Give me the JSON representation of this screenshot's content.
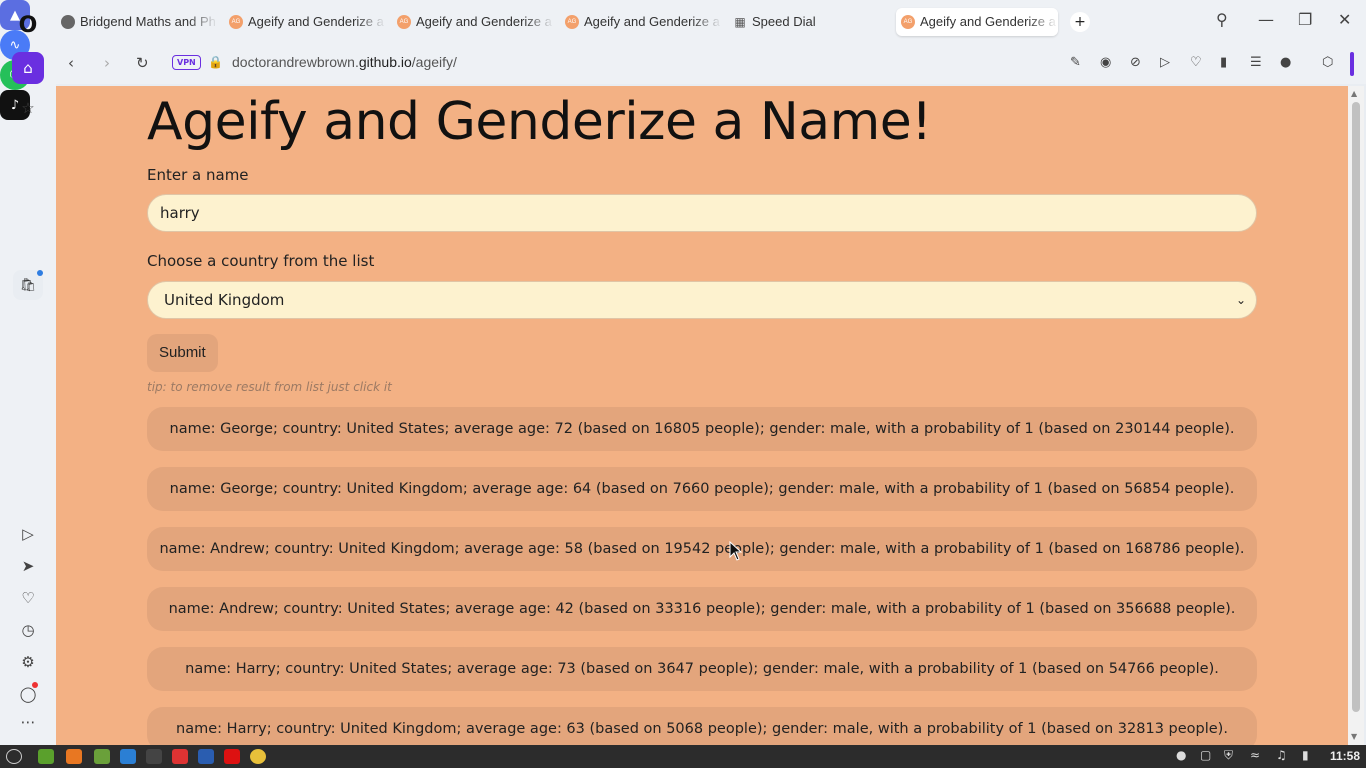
{
  "browser": {
    "tabs": [
      {
        "title": "Bridgend Maths and Ph"
      },
      {
        "title": "Ageify and Genderize a"
      },
      {
        "title": "Ageify and Genderize a"
      },
      {
        "title": "Ageify and Genderize a"
      },
      {
        "title": "Speed Dial"
      },
      {
        "title": "Ageify and Genderize a",
        "active": true
      }
    ],
    "favicon_text": "AG",
    "vpn_label": "VPN",
    "url_domain": "doctorandrewbrown.",
    "url_host": "github.io",
    "url_path": "/ageify/"
  },
  "page": {
    "title": "Ageify and Genderize a Name!",
    "name_label": "Enter a name",
    "name_value": "harry",
    "country_label": "Choose a country from the list",
    "country_selected": "United Kingdom",
    "submit_label": "Submit",
    "tip": "tip: to remove result from list just click it",
    "results": [
      "name: George; country: United States; average age: 72 (based on 16805 people); gender: male, with a probability of 1 (based on 230144 people).",
      "name: George; country: United Kingdom; average age: 64 (based on 7660 people); gender: male, with a probability of 1 (based on 56854 people).",
      "name: Andrew; country: United Kingdom; average age: 58 (based on 19542 people); gender: male, with a probability of 1 (based on 168786 people).",
      "name: Andrew; country: United States; average age: 42 (based on 33316 people); gender: male, with a probability of 1 (based on 356688 people).",
      "name: Harry; country: United States; average age: 73 (based on 3647 people); gender: male, with a probability of 1 (based on 54766 people).",
      "name: Harry; country: United Kingdom; average age: 63 (based on 5068 people); gender: male, with a probability of 1 (based on 32813 people)."
    ]
  },
  "taskbar": {
    "clock": "11:58"
  },
  "colors": {
    "page_background": "#f3b184",
    "input_background": "#fdf2cf",
    "result_background": "#e3a57c",
    "opera_accent": "#6a2fe0"
  }
}
